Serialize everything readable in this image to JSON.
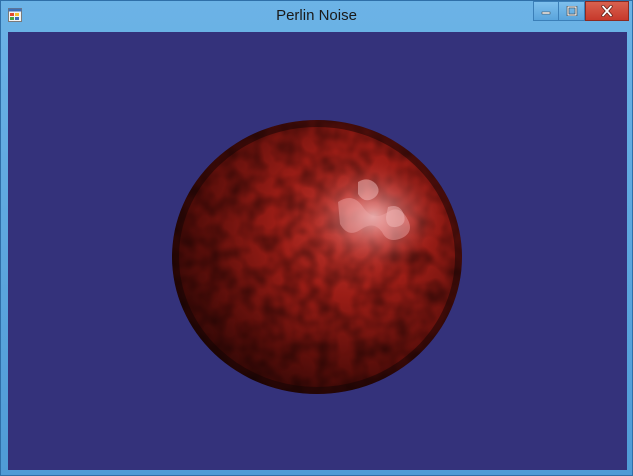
{
  "window": {
    "title": "Perlin Noise",
    "icon": "app-window-icon",
    "controls": {
      "minimize_icon": "minimize-icon",
      "maximize_icon": "maximize-icon",
      "close_icon": "close-icon"
    }
  },
  "scene": {
    "background_color": "#34327b",
    "object": "noise-textured-sphere",
    "object_color": "#8b1a14",
    "highlight_color": "#f2b3b3"
  }
}
